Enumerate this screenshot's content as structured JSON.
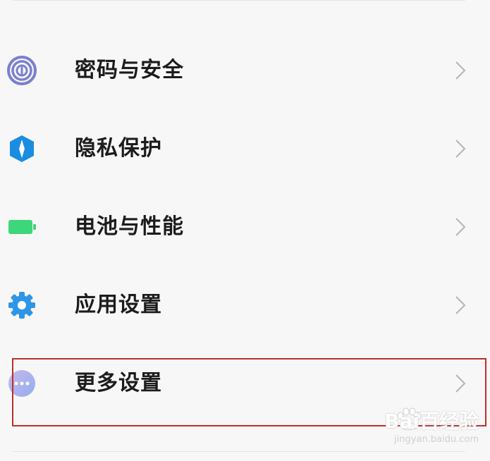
{
  "settings_list": {
    "items": [
      {
        "label": "密码与安全",
        "icon": "fingerprint-icon",
        "icon_color": "#6e73c8"
      },
      {
        "label": "隐私保护",
        "icon": "privacy-shield-icon",
        "icon_color": "#1a8de0"
      },
      {
        "label": "电池与性能",
        "icon": "battery-icon",
        "icon_color": "#3ed67a"
      },
      {
        "label": "应用设置",
        "icon": "gear-icon",
        "icon_color": "#2f95e6"
      },
      {
        "label": "更多设置",
        "icon": "more-dots-icon",
        "icon_color": "#a7b7ee"
      }
    ],
    "highlighted_item_index": 4,
    "highlight_color": "#b9312c"
  },
  "watermark": {
    "main": "Bai百经验",
    "sub": "jingyan.baidu.com"
  }
}
